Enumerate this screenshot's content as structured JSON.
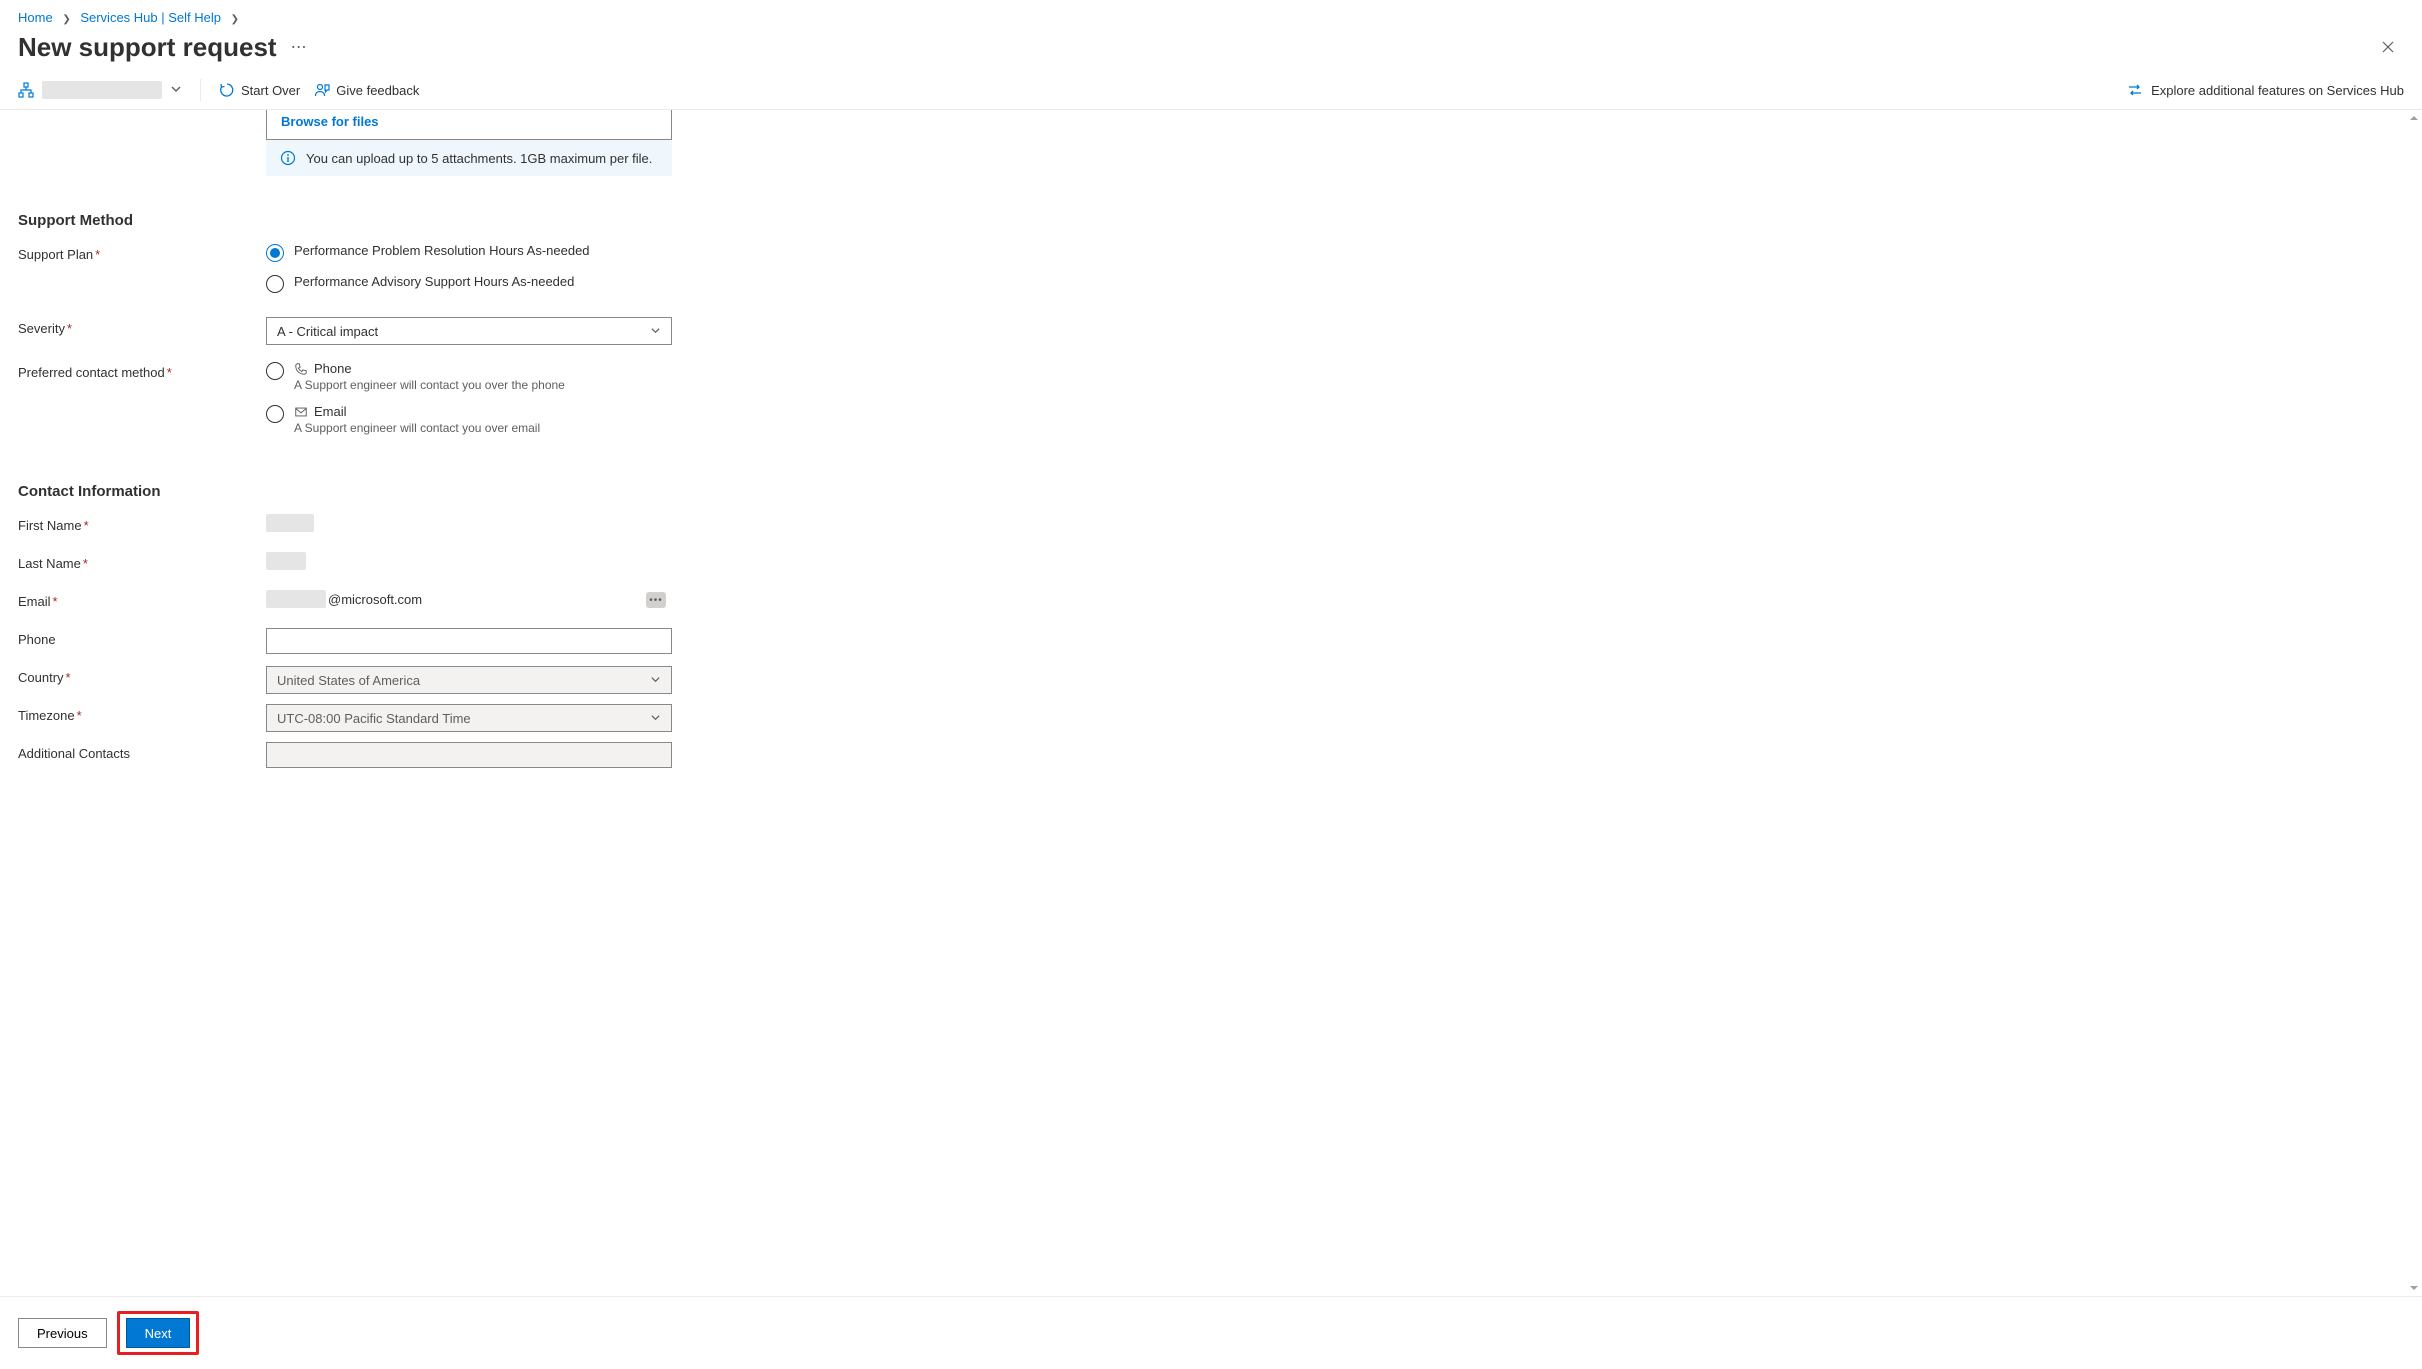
{
  "breadcrumb": {
    "home": "Home",
    "hub": "Services Hub | Self Help"
  },
  "page_title": "New support request",
  "toolbar": {
    "start_over": "Start Over",
    "give_feedback": "Give feedback",
    "explore": "Explore additional features on Services Hub"
  },
  "upload": {
    "browse": "Browse for files",
    "info": "You can upload up to 5 attachments. 1GB maximum per file."
  },
  "sections": {
    "support_method": "Support Method",
    "contact_info": "Contact Information"
  },
  "labels": {
    "support_plan": "Support Plan",
    "severity": "Severity",
    "preferred_contact": "Preferred contact method",
    "first_name": "First Name",
    "last_name": "Last Name",
    "email": "Email",
    "phone": "Phone",
    "country": "Country",
    "timezone": "Timezone",
    "additional_contacts": "Additional Contacts"
  },
  "support_plan": {
    "option1": "Performance Problem Resolution Hours As-needed",
    "option2": "Performance Advisory Support Hours As-needed"
  },
  "severity": {
    "value": "A - Critical impact"
  },
  "contact_method": {
    "phone_label": "Phone",
    "phone_sub": "A Support engineer will contact you over the phone",
    "email_label": "Email",
    "email_sub": "A Support engineer will contact you over email"
  },
  "contact": {
    "email_suffix": "@microsoft.com",
    "country_value": "United States of America",
    "timezone_value": "UTC-08:00 Pacific Standard Time"
  },
  "footer": {
    "previous": "Previous",
    "next": "Next"
  }
}
